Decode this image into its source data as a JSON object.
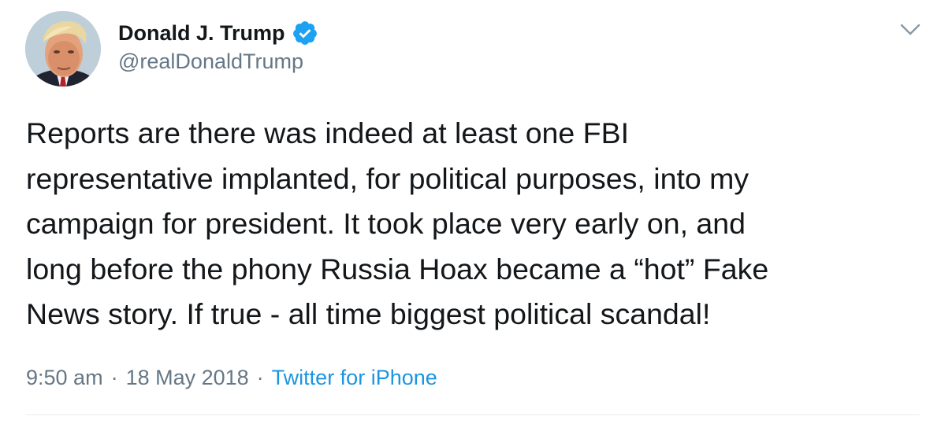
{
  "author": {
    "display_name": "Donald J. Trump",
    "handle": "@realDonaldTrump",
    "verified": true,
    "avatar_icon": "profile-photo",
    "verified_icon": "verified-badge-icon",
    "verified_color": "#1da1f2"
  },
  "tweet": {
    "lines": [
      "Reports are there was indeed at least one FBI",
      "representative implanted, for political purposes, into my",
      "campaign for president. It took place very early on, and",
      "long before the phony Russia Hoax became a “hot” Fake",
      "News story. If true - all time biggest political scandal!"
    ]
  },
  "meta": {
    "time": "9:50 am",
    "separator": "·",
    "date": "18 May 2018",
    "source": "Twitter for iPhone",
    "source_color": "#1b95e0"
  },
  "menu": {
    "icon": "chevron-down-icon"
  }
}
